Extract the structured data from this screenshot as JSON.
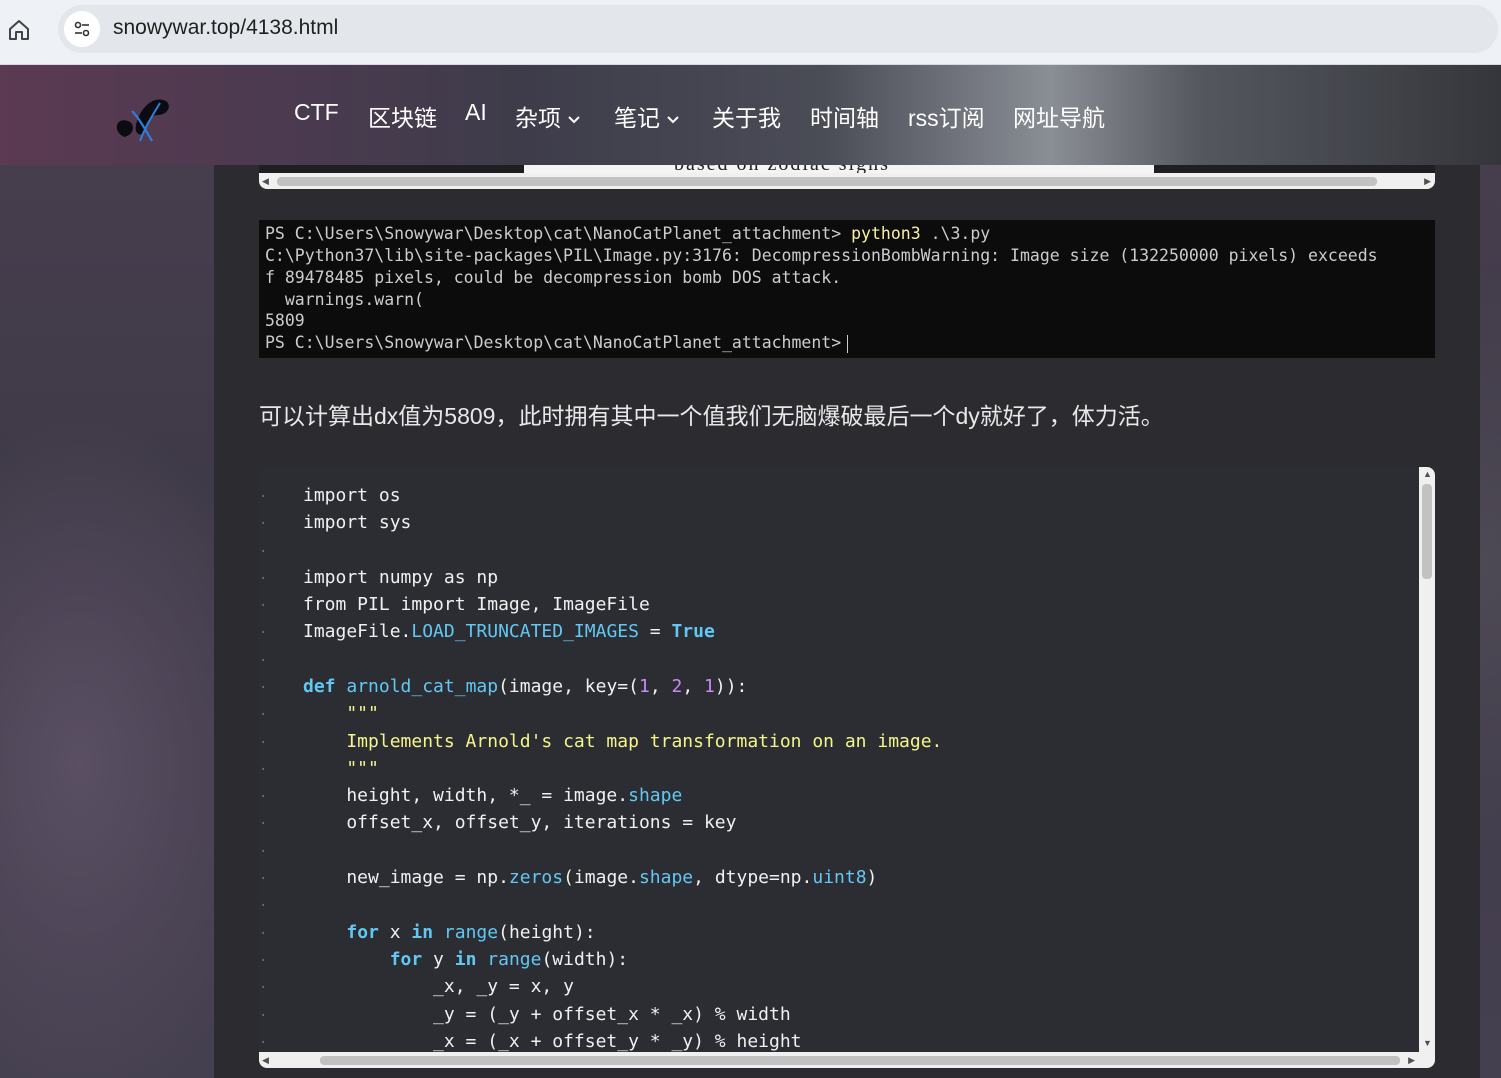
{
  "browser": {
    "url": "snowywar.top/4138.html"
  },
  "nav": {
    "items": [
      {
        "label": "CTF",
        "dropdown": false
      },
      {
        "label": "区块链",
        "dropdown": false
      },
      {
        "label": "AI",
        "dropdown": false
      },
      {
        "label": "杂项",
        "dropdown": true
      },
      {
        "label": "笔记",
        "dropdown": true
      },
      {
        "label": "关于我",
        "dropdown": false
      },
      {
        "label": "时间轴",
        "dropdown": false
      },
      {
        "label": "rss订阅",
        "dropdown": false
      },
      {
        "label": "网址导航",
        "dropdown": false
      }
    ]
  },
  "image_block": {
    "partial_caption": "based on zodiac signs"
  },
  "terminal": {
    "line1_prompt": "PS C:\\Users\\Snowywar\\Desktop\\cat\\NanoCatPlanet_attachment> ",
    "line1_cmd": "python3",
    "line1_arg": " .\\3.py",
    "line2": "C:\\Python37\\lib\\site-packages\\PIL\\Image.py:3176: DecompressionBombWarning: Image size (132250000 pixels) exceeds",
    "line3": "f 89478485 pixels, could be decompression bomb DOS attack.",
    "line4": "  warnings.warn(",
    "line5": "5809",
    "line6": "PS C:\\Users\\Snowywar\\Desktop\\cat\\NanoCatPlanet_attachment>"
  },
  "paragraph": "可以计算出dx值为5809，此时拥有其中一个值我们无脑爆破最后一个dy就好了，体力活。",
  "code": {
    "l1": "import os",
    "l2": "import sys",
    "l4": "import numpy as np",
    "l5": "from PIL import Image, ImageFile",
    "l6a": "ImageFile.",
    "l6b": "LOAD_TRUNCATED_IMAGES",
    "l6c": " = ",
    "l6d": "True",
    "l8a": "def ",
    "l8b": "arnold_cat_map",
    "l8c": "(image, key=(",
    "l8n1": "1",
    "l8s1": ", ",
    "l8n2": "2",
    "l8s2": ", ",
    "l8n3": "1",
    "l8d": ")):",
    "l9": "    \"\"\"",
    "l10": "    Implements Arnold's cat map transformation on an image.",
    "l11": "    \"\"\"",
    "l12a": "    height, width, *_ = image.",
    "l12b": "shape",
    "l13": "    offset_x, offset_y, iterations = key",
    "l15a": "    new_image = np.",
    "l15b": "zeros",
    "l15c": "(image.",
    "l15d": "shape",
    "l15e": ", dtype=np.",
    "l15f": "uint8",
    "l15g": ")",
    "l17a": "    ",
    "l17b": "for",
    "l17c": " x ",
    "l17d": "in",
    "l17e": " ",
    "l17f": "range",
    "l17g": "(height):",
    "l18a": "        ",
    "l18b": "for",
    "l18c": " y ",
    "l18d": "in",
    "l18e": " ",
    "l18f": "range",
    "l18g": "(width):",
    "l19": "            _x, _y = x, y",
    "l20": "            _y = (_y + offset_x * _x) % width",
    "l21": "            _x = (_x + offset_y * _y) % height",
    "dot": "."
  }
}
